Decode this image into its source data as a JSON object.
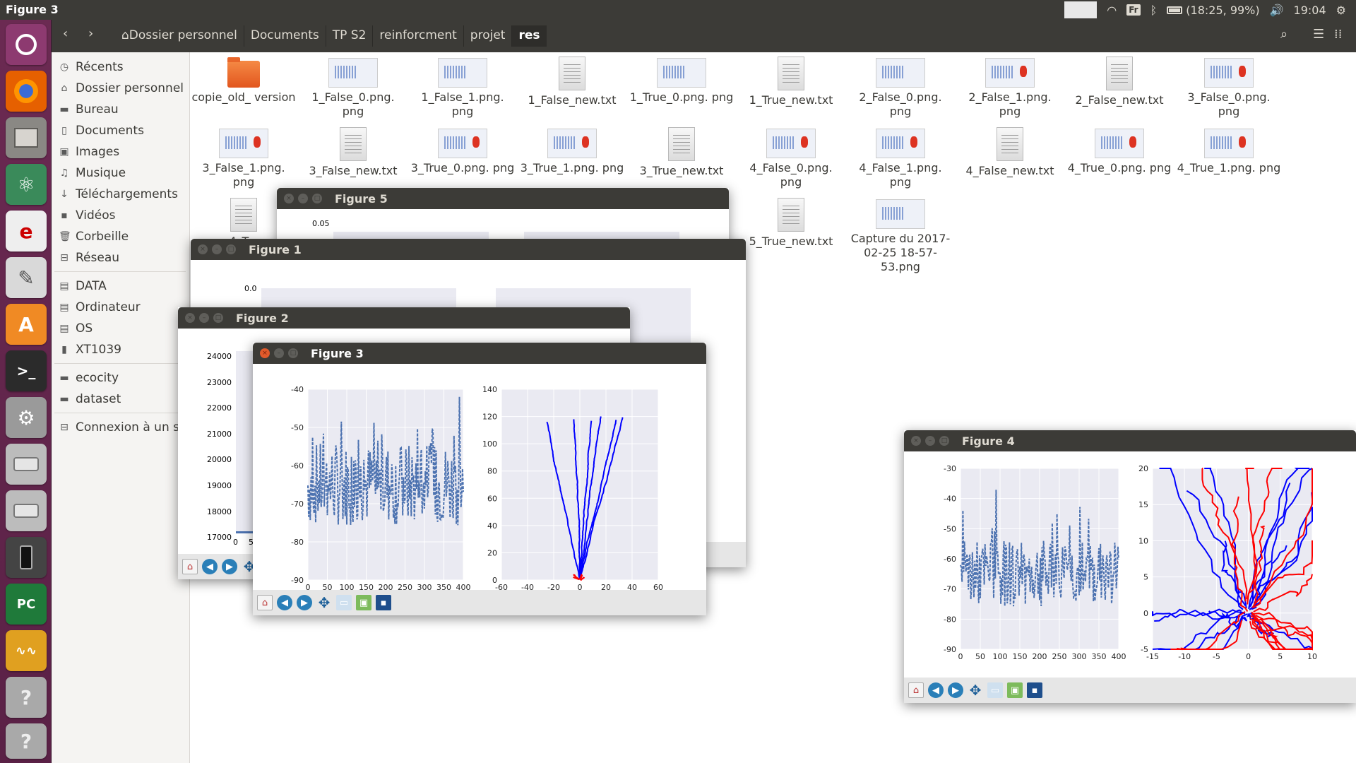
{
  "window_title": "Figure 3",
  "topbar": {
    "keyboard": "Fr",
    "battery": "(18:25, 99%)",
    "clock": "19:04"
  },
  "launcher": [
    "ubuntu-dash",
    "firefox",
    "files",
    "atom",
    "text-editor",
    "notes",
    "software-center",
    "terminal",
    "settings",
    "drive-1",
    "drive-2",
    "phone",
    "pycharm",
    "intellij",
    "octave",
    "help-1",
    "help-2"
  ],
  "navbar": {
    "crumbs": [
      "Dossier personnel",
      "Documents",
      "TP S2",
      "reinforcment",
      "projet",
      "res"
    ]
  },
  "sidebar": {
    "places": [
      "Récents",
      "Dossier personnel",
      "Bureau",
      "Documents",
      "Images",
      "Musique",
      "Téléchargements",
      "Vidéos",
      "Corbeille",
      "Réseau"
    ],
    "devices": [
      "DATA",
      "Ordinateur",
      "OS",
      "XT1039"
    ],
    "bookmarks": [
      "ecocity",
      "dataset"
    ],
    "network": [
      "Connexion à un s..."
    ]
  },
  "files": [
    {
      "name": "copie_old_ version",
      "kind": "folder"
    },
    {
      "name": "1_False_0.png. png",
      "kind": "image"
    },
    {
      "name": "1_False_1.png. png",
      "kind": "image"
    },
    {
      "name": "1_False_new.txt",
      "kind": "text"
    },
    {
      "name": "1_True_0.png. png",
      "kind": "image"
    },
    {
      "name": "1_True_new.txt",
      "kind": "text"
    },
    {
      "name": "2_False_0.png. png",
      "kind": "image"
    },
    {
      "name": "2_False_1.png. png",
      "kind": "image"
    },
    {
      "name": "2_False_new.txt",
      "kind": "text"
    },
    {
      "name": "3_False_0.png. png",
      "kind": "image"
    },
    {
      "name": "3_False_1.png. png",
      "kind": "image"
    },
    {
      "name": "3_False_new.txt",
      "kind": "text"
    },
    {
      "name": "3_True_0.png. png",
      "kind": "image"
    },
    {
      "name": "3_True_1.png. png",
      "kind": "image"
    },
    {
      "name": "3_True_new.txt",
      "kind": "text"
    },
    {
      "name": "4_False_0.png. png",
      "kind": "image"
    },
    {
      "name": "4_False_1.png. png",
      "kind": "image"
    },
    {
      "name": "4_False_new.txt",
      "kind": "text"
    },
    {
      "name": "4_True_0.png. png",
      "kind": "image"
    },
    {
      "name": "4_True_1.png. png",
      "kind": "image"
    },
    {
      "name": "4_T...",
      "kind": "text"
    },
    {
      "name": "5_True_new.txt",
      "kind": "text"
    },
    {
      "name": "Capture du 2017-02-25 18-57-53.png",
      "kind": "image"
    }
  ],
  "windows": {
    "fig5": {
      "title": "Figure 5",
      "tick": "0.05"
    },
    "fig1": {
      "title": "Figure 1",
      "tick": "0.0"
    },
    "fig2": {
      "title": "Figure 2",
      "yticks": [
        "24000",
        "23000",
        "22000",
        "21000",
        "20000",
        "19000",
        "18000",
        "17000"
      ],
      "xticks": [
        "0",
        "5"
      ]
    },
    "fig3": {
      "title": "Figure 3"
    },
    "fig4": {
      "title": "Figure 4"
    }
  },
  "chart_data": [
    {
      "type": "line",
      "figure": "Figure 3",
      "panel": "left",
      "x_range": [
        0,
        400
      ],
      "ylim": [
        -90,
        -40
      ],
      "xticks": [
        "0",
        "50",
        "100",
        "150",
        "200",
        "250",
        "300",
        "350",
        "400"
      ],
      "yticks": [
        "-40",
        "-50",
        "-60",
        "-70",
        "-80",
        "-90"
      ],
      "color": "#4c72b0",
      "style": "dashed",
      "grid": true
    },
    {
      "type": "line",
      "figure": "Figure 3",
      "panel": "right",
      "xlim": [
        -60,
        60
      ],
      "ylim": [
        0,
        140
      ],
      "xticks": [
        "-60",
        "-40",
        "-20",
        "0",
        "20",
        "40",
        "60"
      ],
      "yticks": [
        "0",
        "20",
        "40",
        "60",
        "80",
        "100",
        "120",
        "140"
      ],
      "series": [
        {
          "color": "#0000ff"
        },
        {
          "color": "#ff0000"
        }
      ],
      "grid": true
    },
    {
      "type": "line",
      "figure": "Figure 4",
      "panel": "left",
      "x_range": [
        0,
        400
      ],
      "ylim": [
        -90,
        -30
      ],
      "xticks": [
        "0",
        "50",
        "100",
        "150",
        "200",
        "250",
        "300",
        "350",
        "400"
      ],
      "yticks": [
        "-30",
        "-40",
        "-50",
        "-60",
        "-70",
        "-80",
        "-90"
      ],
      "color": "#4c72b0",
      "style": "dashed",
      "grid": true
    },
    {
      "type": "line",
      "figure": "Figure 4",
      "panel": "right",
      "xlim": [
        -15,
        10
      ],
      "ylim": [
        -5,
        20
      ],
      "xticks": [
        "-15",
        "-10",
        "-5",
        "0",
        "5",
        "10"
      ],
      "yticks": [
        "20",
        "15",
        "10",
        "5",
        "0",
        "-5"
      ],
      "series": [
        {
          "color": "#0000ff"
        },
        {
          "color": "#ff0000"
        }
      ],
      "grid": true
    }
  ]
}
